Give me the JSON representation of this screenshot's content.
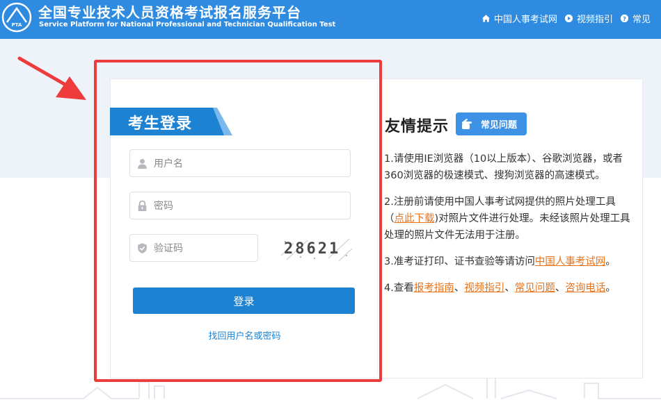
{
  "header": {
    "title_cn": "全国专业技术人员资格考试报名服务平台",
    "title_en": "Service Platform for National Professional and Technician Qualification Test",
    "logo_text": "PTA",
    "nav": [
      {
        "label": "中国人事考试网",
        "icon": "home-icon"
      },
      {
        "label": "视频指引",
        "icon": "play-icon"
      },
      {
        "label": "常见",
        "icon": "help-icon"
      }
    ]
  },
  "login": {
    "title": "考生登录",
    "username_placeholder": "用户名",
    "password_placeholder": "密码",
    "captcha_placeholder": "验证码",
    "captcha_text": "28621",
    "submit_label": "登录",
    "recover_link": "找回用户名或密码"
  },
  "tips": {
    "title": "友情提示",
    "faq_button": "常见问题",
    "t1": "1.请使用IE浏览器（10以上版本）、谷歌浏览器，或者360浏览器的极速模式、搜狗浏览器的高速模式。",
    "t2_pre": "2.注册前请使用中国人事考试网提供的照片处理工具（",
    "t2_link": "点此下载",
    "t2_post": ")对照片文件进行处理。未经该照片处理工具处理的照片文件无法用于注册。",
    "t3_pre": "3.准考证打印、证书查验等请访问",
    "t3_link": "中国人事考试网",
    "t3_post": "。",
    "t4_pre": "4.查看",
    "t4_l1": "报考指南",
    "t4_s1": "、",
    "t4_l2": "视频指引",
    "t4_s2": "、",
    "t4_l3": "常见问题",
    "t4_s3": "、",
    "t4_l4": "咨询电话",
    "t4_post": "。"
  },
  "colors": {
    "header_bg": "#2f8be0",
    "primary": "#1e82d2",
    "link_orange": "#e8731a",
    "highlight_red": "#ee3b3b"
  }
}
